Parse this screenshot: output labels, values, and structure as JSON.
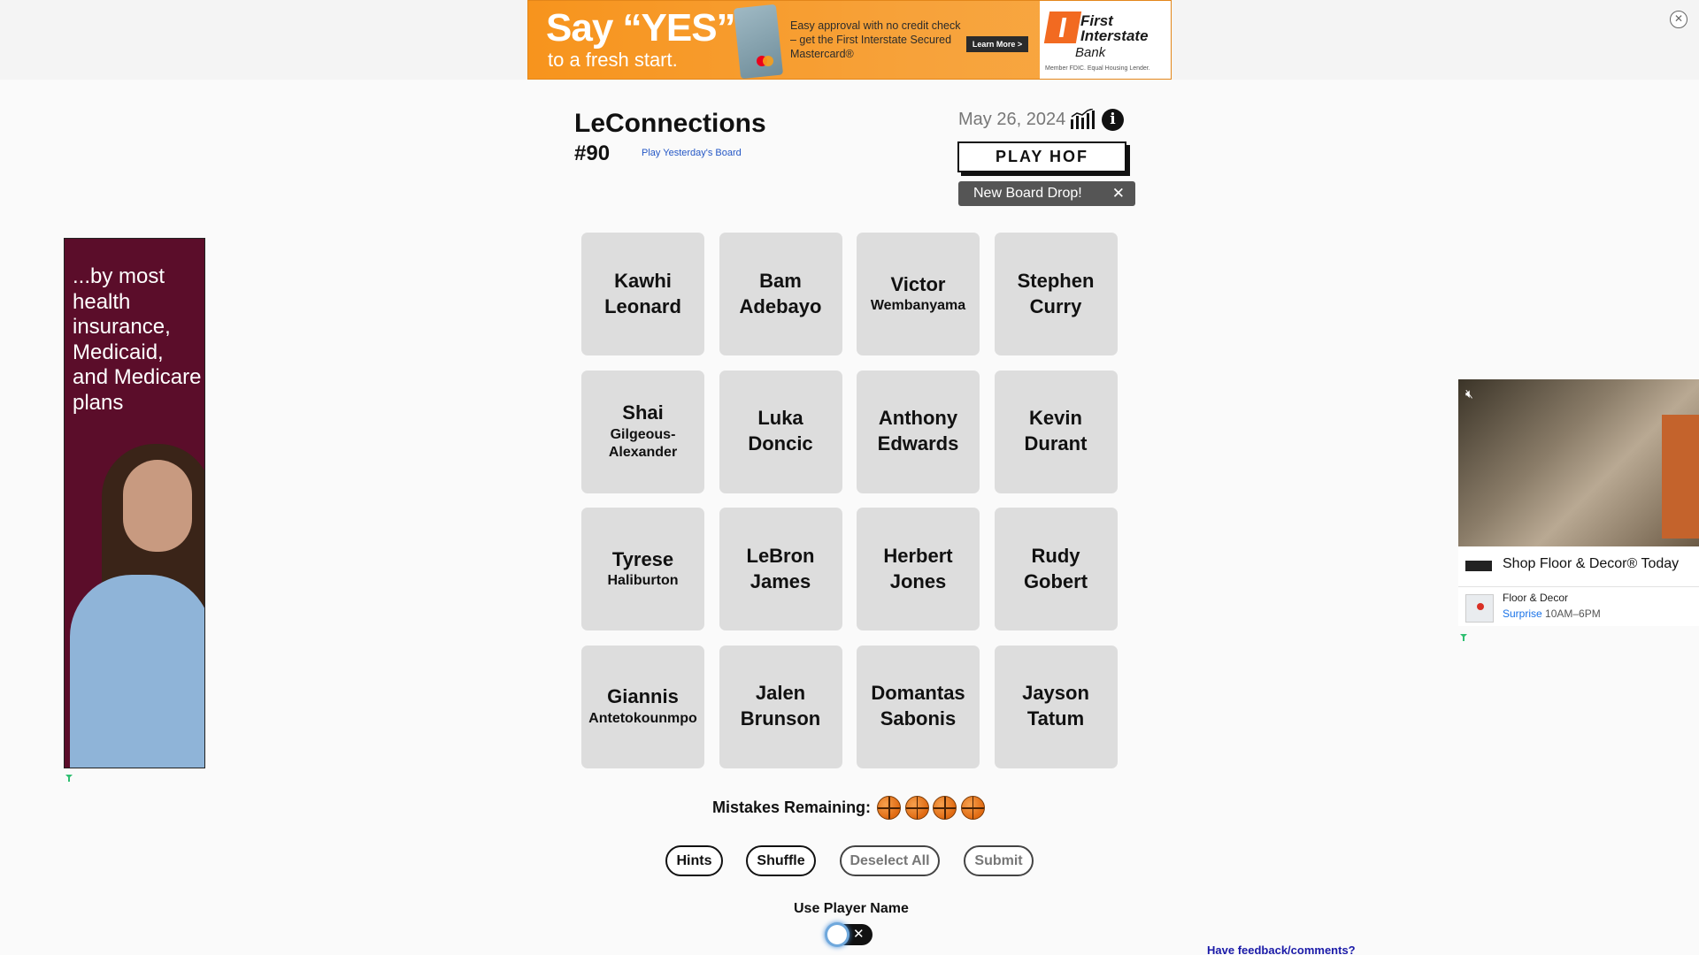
{
  "top_ad": {
    "headline": "Say “YES”",
    "subline": "to a fresh start.",
    "copy": "Easy approval with no credit check – get the First Interstate Secured Mastercard®",
    "cta": "Learn More >",
    "bank_name": "First Interstate",
    "bank_sub": "Bank",
    "member_text": "Member FDIC. Equal Housing Lender."
  },
  "header": {
    "title": "LeConnections",
    "game_number": "#90",
    "yesterday_link": "Play Yesterday's Board",
    "date": "May 26, 2024",
    "hof_button": "PLAY HOF",
    "toast": "New Board Drop!"
  },
  "tiles": [
    {
      "first": "Kawhi",
      "last": "Leonard",
      "small_last": false
    },
    {
      "first": "Bam",
      "last": "Adebayo",
      "small_last": false
    },
    {
      "first": "Victor",
      "last": "Wembanyama",
      "small_last": true
    },
    {
      "first": "Stephen",
      "last": "Curry",
      "small_last": false
    },
    {
      "first": "Shai",
      "last": "Gilgeous-Alexander",
      "small_last": true
    },
    {
      "first": "Luka",
      "last": "Doncic",
      "small_last": false
    },
    {
      "first": "Anthony",
      "last": "Edwards",
      "small_last": false
    },
    {
      "first": "Kevin",
      "last": "Durant",
      "small_last": false
    },
    {
      "first": "Tyrese",
      "last": "Haliburton",
      "small_last": true
    },
    {
      "first": "LeBron",
      "last": "James",
      "small_last": false
    },
    {
      "first": "Herbert",
      "last": "Jones",
      "small_last": false
    },
    {
      "first": "Rudy",
      "last": "Gobert",
      "small_last": false
    },
    {
      "first": "Giannis",
      "last": "Antetokounmpo",
      "small_last": true
    },
    {
      "first": "Jalen",
      "last": "Brunson",
      "small_last": false
    },
    {
      "first": "Domantas",
      "last": "Sabonis",
      "small_last": false
    },
    {
      "first": "Jayson",
      "last": "Tatum",
      "small_last": false
    }
  ],
  "mistakes": {
    "label": "Mistakes Remaining:",
    "remaining": 4
  },
  "buttons": {
    "hints": "Hints",
    "shuffle": "Shuffle",
    "deselect_all": "Deselect All",
    "submit": "Submit"
  },
  "toggle": {
    "label": "Use Player Name",
    "state": "off"
  },
  "feedback_link": "Have feedback/comments?",
  "left_ad": {
    "text": "...by most health insurance, Medicaid, and Medicare plans"
  },
  "right_ad": {
    "headline": "Shop Floor & Decor® Today",
    "store": "Floor & Decor",
    "location": "Surprise",
    "hours": "10AM–6PM"
  },
  "icons": {
    "close_ad": "close-icon",
    "stats": "bar-chart-icon",
    "info": "info-icon",
    "toast_close": "close-icon",
    "mute": "mute-icon",
    "ball": "basketball-icon"
  },
  "colors": {
    "tile_bg": "#dddddd",
    "page_bg": "#fafafa",
    "toast_bg": "#555555",
    "link": "#2457c5",
    "ad_orange": "#f7941d",
    "ad_maroon": "#5b0d2a"
  }
}
